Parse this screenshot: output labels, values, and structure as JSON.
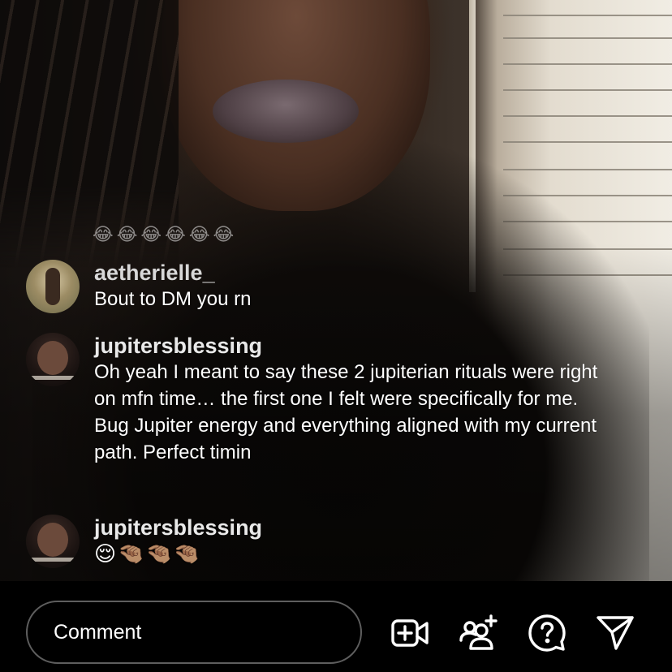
{
  "live": {
    "faded_reactions": "😂😂😂😂😂😂",
    "comments": [
      {
        "username": "aetherielle_",
        "text": "Bout to DM you rn"
      },
      {
        "username": "jupitersblessing",
        "text": "Oh yeah I meant to say these 2 jupiterian rituals were right on mfn time… the first one I felt were specifically for me. Bug Jupiter energy and everything aligned with my current path. Perfect timin"
      },
      {
        "username": "jupitersblessing",
        "text": "😌🤏🏽🤏🏽🤏🏽"
      }
    ]
  },
  "bottom_bar": {
    "comment_placeholder": "Comment",
    "icons": [
      "add-video-icon",
      "add-guest-icon",
      "question-icon",
      "send-icon"
    ]
  }
}
